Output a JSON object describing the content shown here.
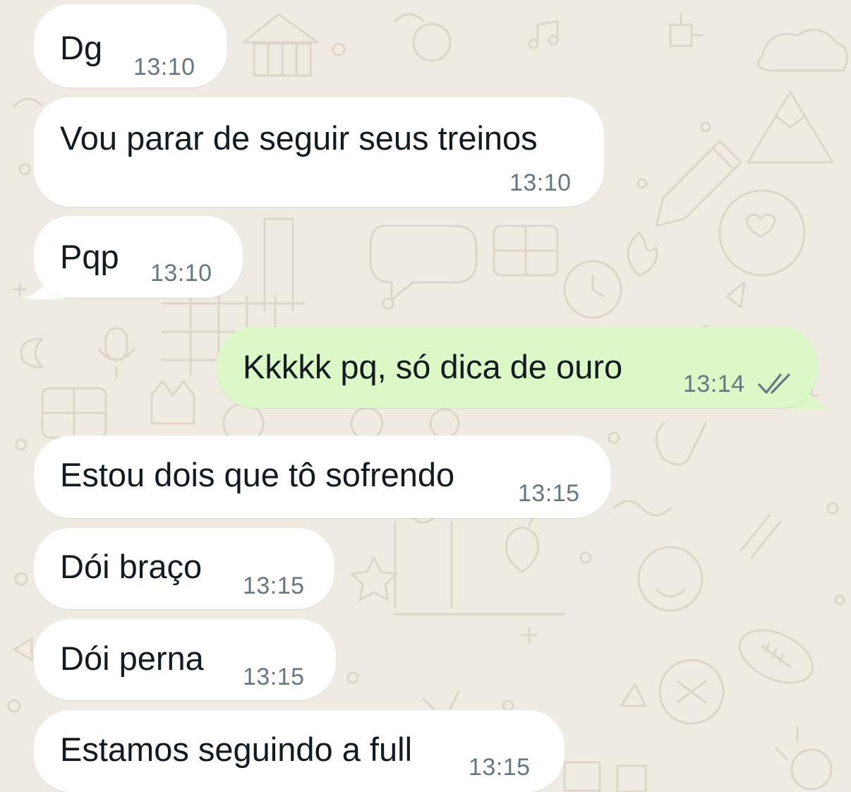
{
  "conversation": {
    "messages": [
      {
        "direction": "incoming",
        "text": "Dg",
        "time": "13:10"
      },
      {
        "direction": "incoming",
        "text": "Vou parar de seguir seus treinos",
        "time": "13:10"
      },
      {
        "direction": "incoming",
        "text": "Pqp",
        "time": "13:10"
      },
      {
        "direction": "outgoing",
        "text": "Kkkkk pq, só dica de ouro",
        "time": "13:14",
        "status": "read",
        "status_icon": "double-check-icon"
      },
      {
        "direction": "incoming",
        "text": "Estou dois que tô sofrendo",
        "time": "13:15"
      },
      {
        "direction": "incoming",
        "text": "Dói braço",
        "time": "13:15"
      },
      {
        "direction": "incoming",
        "text": "Dói perna",
        "time": "13:15"
      },
      {
        "direction": "incoming",
        "text": "Estamos seguindo a full",
        "time": "13:15"
      }
    ]
  },
  "theme": {
    "background": "#efeae2",
    "incoming_bubble": "#ffffff",
    "outgoing_bubble": "#dcf8c6",
    "text_color": "#111b21",
    "time_color": "#667781",
    "tick_color": "#667781"
  }
}
